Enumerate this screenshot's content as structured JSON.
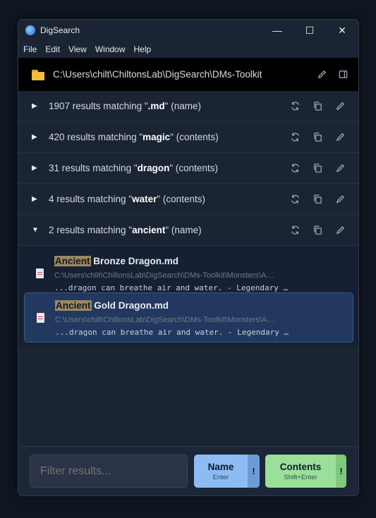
{
  "window": {
    "title": "DigSearch",
    "minimize": "—",
    "maximize": "☐",
    "close": "✕"
  },
  "menu": [
    "File",
    "Edit",
    "View",
    "Window",
    "Help"
  ],
  "path": {
    "text": "C:\\Users\\chilt\\ChiltonsLab\\DigSearch\\DMs-Toolkit"
  },
  "groups": [
    {
      "count": "1907",
      "pre": " results matching \"",
      "term": ".md",
      "post": "\" (name)",
      "expanded": false
    },
    {
      "count": "420",
      "pre": " results matching \"",
      "term": "magic",
      "post": "\" (contents)",
      "expanded": false
    },
    {
      "count": "31",
      "pre": " results matching \"",
      "term": "dragon",
      "post": "\" (contents)",
      "expanded": false
    },
    {
      "count": "4",
      "pre": " results matching \"",
      "term": "water",
      "post": "\" (contents)",
      "expanded": false
    },
    {
      "count": "2",
      "pre": " results matching \"",
      "term": "ancient",
      "post": "\" (name)",
      "expanded": true
    }
  ],
  "results": [
    {
      "highlight": "Ancient",
      "rest": " Bronze Dragon.md",
      "path": "C:\\Users\\chilt\\ChiltonsLab\\DigSearch\\DMs-Toolkit\\Monsters\\A…",
      "snippet": "...dragon can breathe air and water. - Legendary …",
      "selected": false
    },
    {
      "highlight": "Ancient",
      "rest": " Gold Dragon.md",
      "path": "C:\\Users\\chilt\\ChiltonsLab\\DigSearch\\DMs-Toolkit\\Monsters\\A…",
      "snippet": "...dragon can breathe air and water. - Legendary …",
      "selected": true
    }
  ],
  "footer": {
    "filter_placeholder": "Filter results...",
    "name_label": "Name",
    "name_shortcut": "Enter",
    "contents_label": "Contents",
    "contents_shortcut": "Shift+Enter",
    "bang": "!"
  },
  "colors": {
    "background": "#0f1621",
    "window": "#1a2433",
    "selected": "#22385e",
    "highlight": "#9a8866",
    "name_button": "#8cbcf2",
    "contents_button": "#9be09a",
    "folder": "#f4bd38"
  },
  "icons": {
    "group_actions": [
      "refresh-icon",
      "copy-icon",
      "edit-icon"
    ],
    "path_actions": [
      "edit-icon",
      "panel-toggle-icon"
    ]
  }
}
